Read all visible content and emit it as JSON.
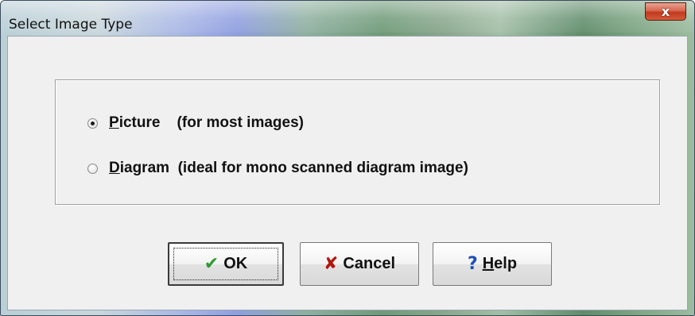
{
  "window": {
    "title": "Select Image Type",
    "close_glyph": "x"
  },
  "options": {
    "picture": {
      "accel": "P",
      "rest": "icture",
      "desc": "    (for most images)",
      "checked": true
    },
    "diagram": {
      "accel": "D",
      "rest": "iagram",
      "desc": "  (ideal for mono scanned diagram image)",
      "checked": false
    }
  },
  "buttons": {
    "ok_label": "OK",
    "cancel_label": "Cancel",
    "help_accel": "H",
    "help_rest": "elp"
  },
  "icons": {
    "ok": "check-icon",
    "cancel": "x-icon",
    "help": "question-icon"
  },
  "colors": {
    "check": "#2f9a2f",
    "cancel_x": "#b3150f",
    "help_q": "#1d4fb8",
    "close_button": "#c0391e"
  }
}
